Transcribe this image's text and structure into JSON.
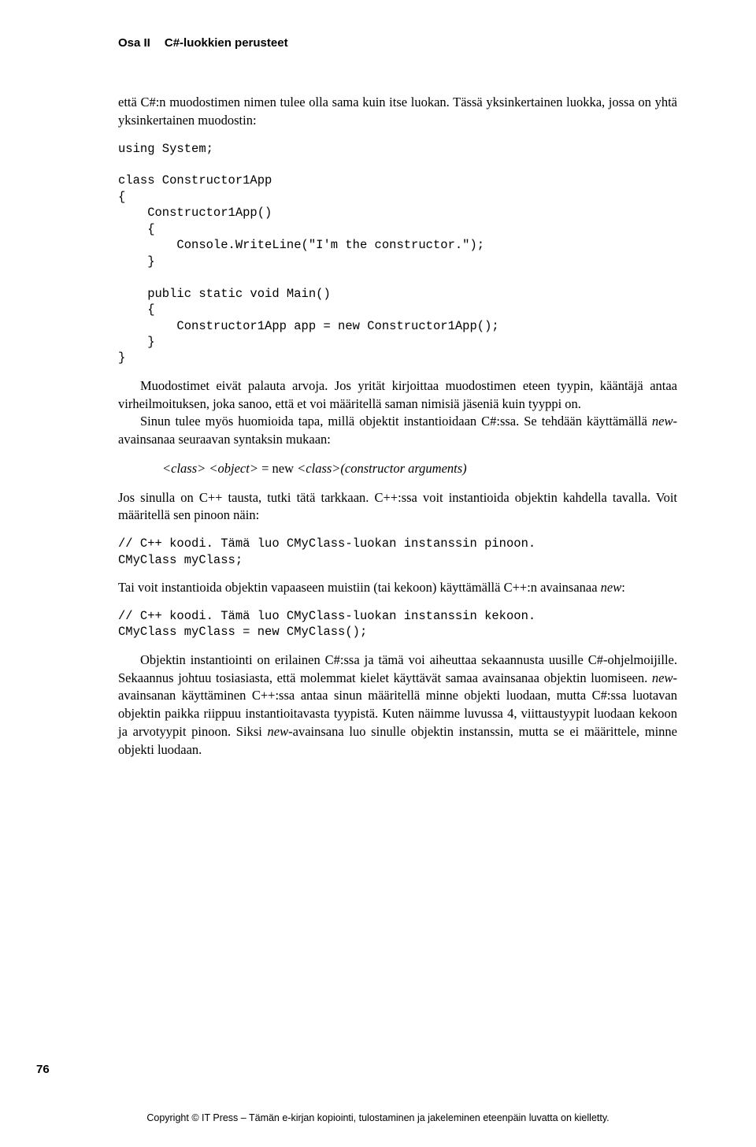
{
  "header": {
    "part": "Osa II",
    "title": "C#-luokkien perusteet"
  },
  "para1": "että C#:n muodostimen nimen tulee olla sama kuin itse luokan. Tässä yksinkertainen luokka, jossa on yhtä yksinkertainen muodostin:",
  "code1": "using System;\n\nclass Constructor1App\n{\n    Constructor1App()\n    {\n        Console.WriteLine(\"I'm the constructor.\");\n    }\n\n    public static void Main()\n    {\n        Constructor1App app = new Constructor1App();\n    }\n}",
  "para2": "Muodostimet eivät palauta arvoja. Jos yrität kirjoittaa muodostimen eteen tyypin, kääntäjä antaa virheilmoituksen, joka sanoo, että et voi määritellä saman nimisiä jäseniä kuin tyyppi on.",
  "para3a": "Sinun tulee myös huomioida tapa, millä objektit instantioidaan C#:ssa. Se tehdään käyttämällä ",
  "para3b": "new",
  "para3c": "-avainsanaa seuraavan syntaksin mukaan:",
  "syntax": {
    "s1": "<class> <object>",
    "s2": " = new ",
    "s3": "<class>(constructor arguments)"
  },
  "para4": "Jos sinulla on C++ tausta, tutki tätä tarkkaan. C++:ssa voit instantioida objektin kahdella tavalla. Voit määritellä sen pinoon näin:",
  "code2": "// C++ koodi. Tämä luo CMyClass-luokan instanssin pinoon.\nCMyClass myClass;",
  "para5a": "Tai voit instantioida objektin vapaaseen muistiin (tai kekoon) käyttämällä C++:n avainsanaa ",
  "para5b": "new",
  "para5c": ":",
  "code3": "// C++ koodi. Tämä luo CMyClass-luokan instanssin kekoon.\nCMyClass myClass = new CMyClass();",
  "para6a": "Objektin instantiointi on erilainen C#:ssa ja tämä voi aiheuttaa sekaannusta uusille C#-ohjelmoijille. Sekaannus johtuu tosiasiasta, että molemmat kielet käyttävät samaa avainsanaa objektin luomiseen. ",
  "para6b": "new",
  "para6c": "-avainsanan käyttäminen C++:ssa antaa sinun määritellä minne objekti luodaan, mutta C#:ssa luotavan objektin paikka riippuu instantioitavasta tyypistä. Kuten näimme luvussa 4, viittaustyypit luodaan kekoon ja arvotyypit pinoon. Siksi ",
  "para6d": "new",
  "para6e": "-avainsana luo sinulle objektin instanssin, mutta se ei määrittele, minne objekti luodaan.",
  "pageNumber": "76",
  "footer": "Copyright © IT Press – Tämän e-kirjan kopiointi, tulostaminen ja jakeleminen eteenpäin luvatta on kielletty."
}
